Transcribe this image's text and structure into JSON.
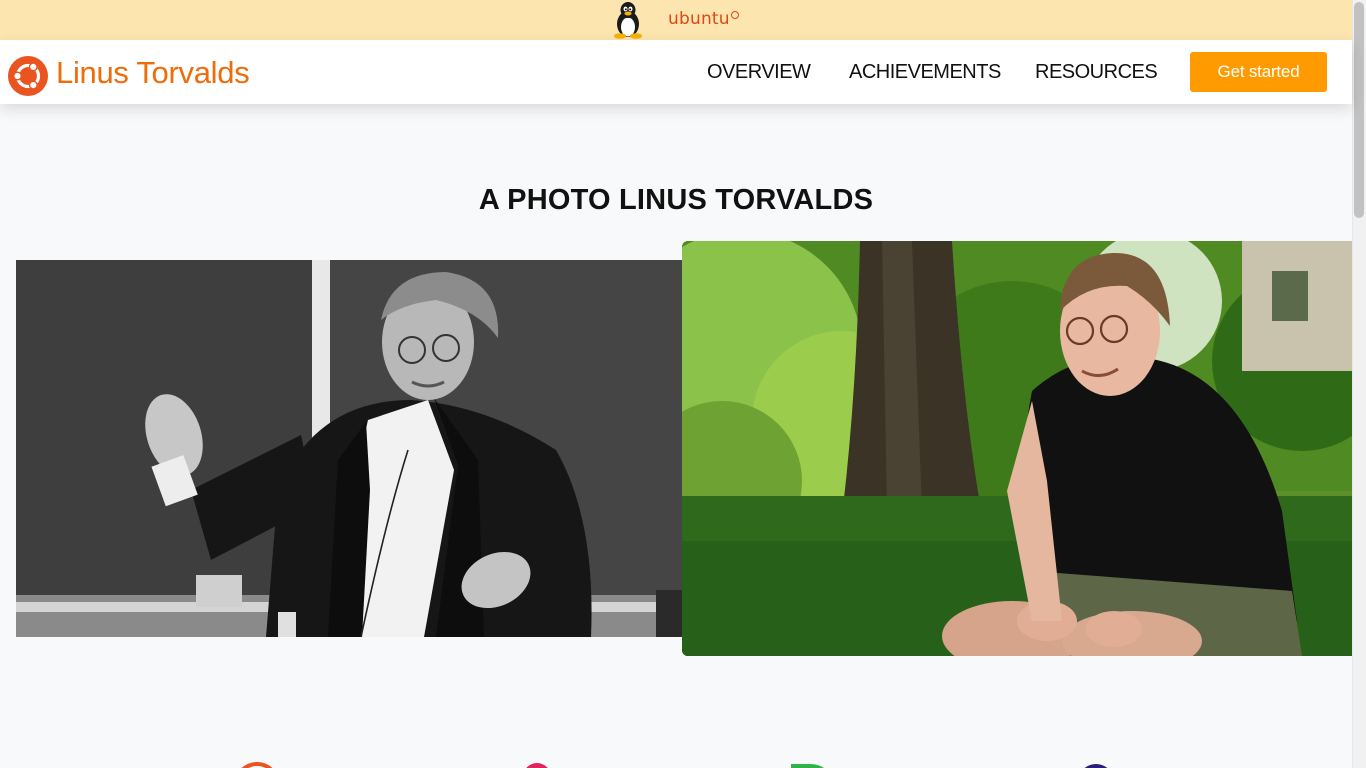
{
  "banner": {
    "logo_icon": "linux-penguin-icon",
    "wordmark": "ubuntu",
    "wordmark_color": "#dd4814",
    "background": "#fde5b0"
  },
  "brand": {
    "icon": "ubuntu-circle-of-friends-icon",
    "name": "Linus Torvalds",
    "color": "#ee6c0a"
  },
  "nav": {
    "items": [
      {
        "label": "OVERVIEW"
      },
      {
        "label": "ACHIEVEMENTS"
      },
      {
        "label": "RESOURCES"
      }
    ],
    "cta_label": "Get started",
    "cta_color": "#ff9a00"
  },
  "gallery": {
    "title": "A PHOTO LINUS TORVALDS",
    "photos": [
      {
        "name": "black-and-white-lecture-photo"
      },
      {
        "name": "outdoor-garden-photo"
      }
    ]
  },
  "bottom_icons": [
    "orange-circle-icon",
    "pink-circle-icon",
    "green-d-icon",
    "navy-circle-icon"
  ]
}
